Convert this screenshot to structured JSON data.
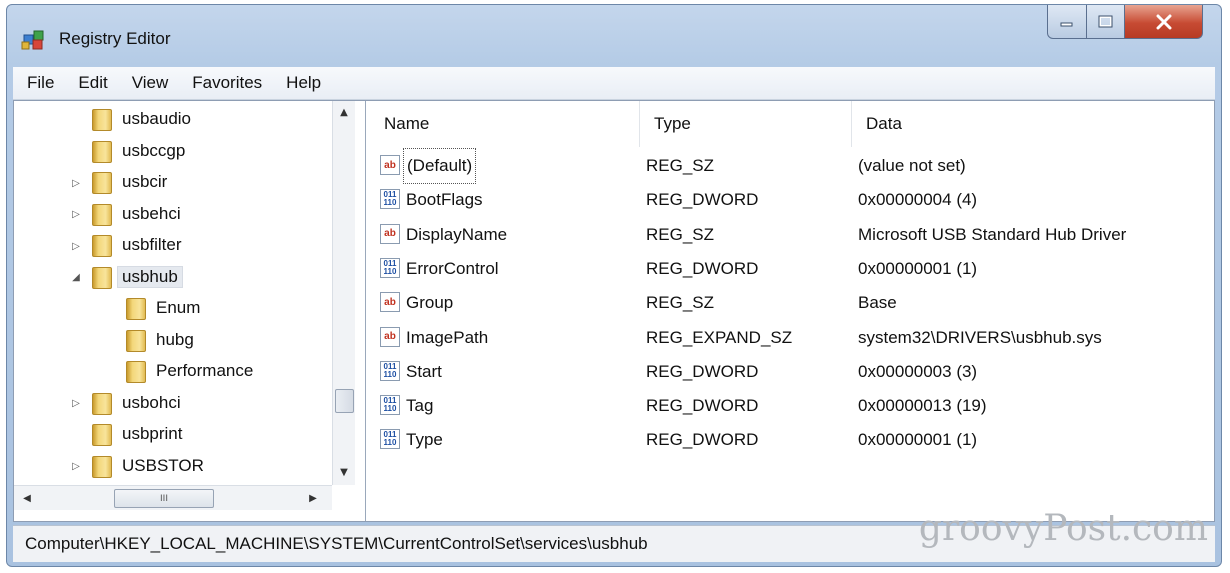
{
  "window": {
    "title": "Registry Editor",
    "buttons": {
      "minimize": "minimize",
      "maximize": "maximize",
      "close": "close"
    }
  },
  "menu": [
    "File",
    "Edit",
    "View",
    "Favorites",
    "Help"
  ],
  "tree": {
    "items": [
      {
        "label": "usbaudio",
        "expander": "none"
      },
      {
        "label": "usbccgp",
        "expander": "none"
      },
      {
        "label": "usbcir",
        "expander": "collapsed"
      },
      {
        "label": "usbehci",
        "expander": "collapsed"
      },
      {
        "label": "usbfilter",
        "expander": "collapsed"
      },
      {
        "label": "usbhub",
        "expander": "expanded",
        "selected": true
      },
      {
        "label": "Enum",
        "expander": "none",
        "child": true
      },
      {
        "label": "hubg",
        "expander": "none",
        "child": true
      },
      {
        "label": "Performance",
        "expander": "none",
        "child": true
      },
      {
        "label": "usbohci",
        "expander": "collapsed"
      },
      {
        "label": "usbprint",
        "expander": "none"
      },
      {
        "label": "USBSTOR",
        "expander": "collapsed"
      }
    ],
    "hscroll_thumb_glyph": "III"
  },
  "list": {
    "columns": {
      "name": "Name",
      "type": "Type",
      "data": "Data"
    },
    "rows": [
      {
        "icon": "ab",
        "name": "(Default)",
        "type": "REG_SZ",
        "data": "(value not set)"
      },
      {
        "icon": "bin",
        "name": "BootFlags",
        "type": "REG_DWORD",
        "data": "0x00000004 (4)"
      },
      {
        "icon": "ab",
        "name": "DisplayName",
        "type": "REG_SZ",
        "data": "Microsoft USB Standard Hub Driver"
      },
      {
        "icon": "bin",
        "name": "ErrorControl",
        "type": "REG_DWORD",
        "data": "0x00000001 (1)"
      },
      {
        "icon": "ab",
        "name": "Group",
        "type": "REG_SZ",
        "data": "Base"
      },
      {
        "icon": "ab",
        "name": "ImagePath",
        "type": "REG_EXPAND_SZ",
        "data": "system32\\DRIVERS\\usbhub.sys"
      },
      {
        "icon": "bin",
        "name": "Start",
        "type": "REG_DWORD",
        "data": "0x00000003 (3)"
      },
      {
        "icon": "bin",
        "name": "Tag",
        "type": "REG_DWORD",
        "data": "0x00000013 (19)"
      },
      {
        "icon": "bin",
        "name": "Type",
        "type": "REG_DWORD",
        "data": "0x00000001 (1)"
      }
    ]
  },
  "status": {
    "path": "Computer\\HKEY_LOCAL_MACHINE\\SYSTEM\\CurrentControlSet\\services\\usbhub"
  },
  "watermark": "groovyPost.com"
}
